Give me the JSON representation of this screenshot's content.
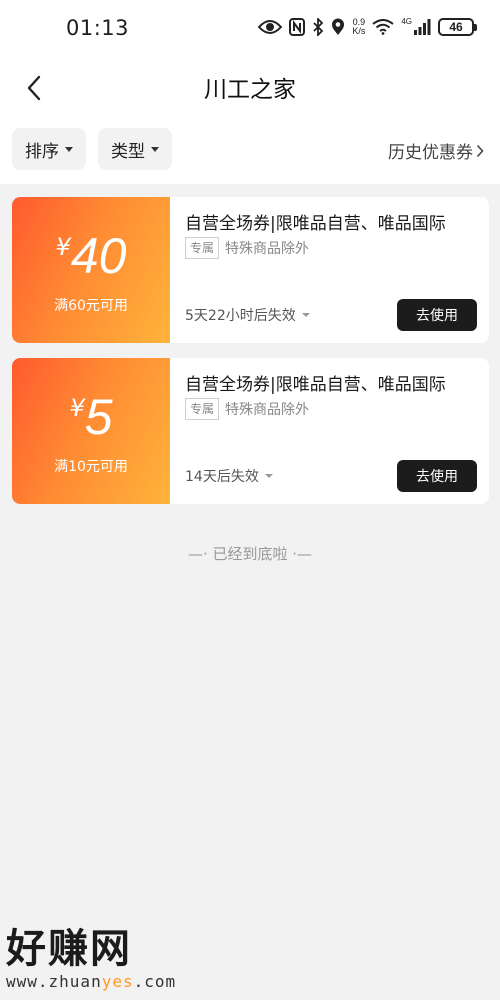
{
  "status_bar": {
    "time": "01:13",
    "net_speed_top": "0.9",
    "net_speed_bottom": "K/s",
    "network_type": "4G",
    "battery": "46",
    "icons": [
      "eye-icon",
      "nfc-icon",
      "bluetooth-icon",
      "location-icon",
      "wifi-icon",
      "signal-icon",
      "battery-icon"
    ]
  },
  "header": {
    "title": "川工之家",
    "back_icon": "chevron-left-icon"
  },
  "filters": {
    "sort_label": "排序",
    "type_label": "类型",
    "history_label": "历史优惠券"
  },
  "coupons": [
    {
      "currency": "¥",
      "amount": "40",
      "threshold": "满60元可用",
      "title": "自营全场券|限唯品自营、唯品国际",
      "tag": "专属",
      "note": "特殊商品除外",
      "expiry": "5天22小时后失效",
      "action": "去使用"
    },
    {
      "currency": "¥",
      "amount": "5",
      "threshold": "满10元可用",
      "title": "自营全场券|限唯品自营、唯品国际",
      "tag": "专属",
      "note": "特殊商品除外",
      "expiry": "14天后失效",
      "action": "去使用"
    }
  ],
  "footer": {
    "end_text": "—· 已经到底啦 ·—"
  },
  "watermark": {
    "brand": "好赚网",
    "url_part1": "www.zhuan",
    "url_part2": "yes",
    "url_part3": ".com"
  },
  "colors": {
    "coupon_gradient_start": "#ff5a2e",
    "coupon_gradient_end": "#ffb43b",
    "button_bg": "#1c1c1c",
    "page_bg": "#f2f2f2",
    "watermark_accent": "#ff9a1f"
  }
}
